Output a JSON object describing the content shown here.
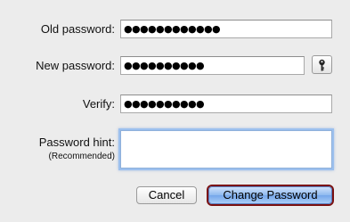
{
  "form": {
    "old_password_label": "Old password:",
    "old_password_value": "●●●●●●●●●●●●",
    "new_password_label": "New password:",
    "new_password_value": "●●●●●●●●●●",
    "verify_label": "Verify:",
    "verify_value": "●●●●●●●●●●",
    "hint_label": "Password hint:",
    "hint_sublabel": "(Recommended)",
    "hint_value": ""
  },
  "buttons": {
    "cancel_label": "Cancel",
    "change_label": "Change Password"
  },
  "icons": {
    "password_assistant": "key-icon"
  },
  "colors": {
    "background": "#ececec",
    "focus_ring": "#9cc0ee",
    "default_button": "#8eb9ef",
    "default_button_outline": "#7a1010"
  }
}
